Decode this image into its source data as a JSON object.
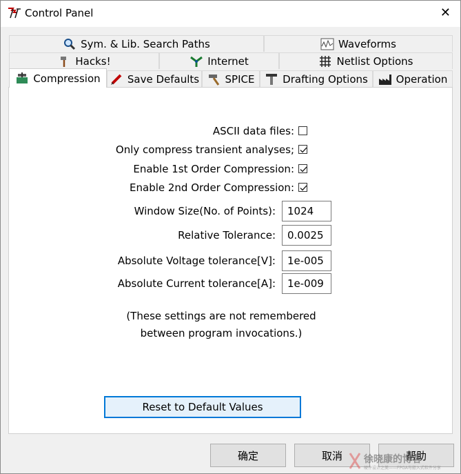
{
  "window": {
    "title": "Control Panel",
    "close_glyph": "✕"
  },
  "tabs_row1": [
    {
      "label": "Sym. & Lib. Search Paths",
      "icon": "magnifier-icon"
    },
    {
      "label": "Waveforms",
      "icon": "waveform-icon"
    }
  ],
  "tabs_row2": [
    {
      "label": "Hacks!",
      "icon": "axe-icon"
    },
    {
      "label": "Internet",
      "icon": "network-icon"
    },
    {
      "label": "Netlist Options",
      "icon": "netlist-grid-icon"
    }
  ],
  "tabs_row3": [
    {
      "label": "Compression",
      "icon": "compression-clamp-icon",
      "active": true
    },
    {
      "label": "Save Defaults",
      "icon": "pen-icon"
    },
    {
      "label": "SPICE",
      "icon": "hammer-icon"
    },
    {
      "label": "Drafting Options",
      "icon": "t-square-icon"
    },
    {
      "label": "Operation",
      "icon": "factory-icon"
    }
  ],
  "settings": {
    "ascii": {
      "label": "ASCII data files:",
      "checked": false
    },
    "only_transient": {
      "label": "Only compress transient analyses;",
      "checked": true
    },
    "first_order": {
      "label": "Enable 1st Order Compression:",
      "checked": true
    },
    "second_order": {
      "label": "Enable 2nd Order Compression:",
      "checked": true
    },
    "window_size": {
      "label": "Window Size(No. of Points):",
      "value": "1024"
    },
    "rel_tol": {
      "label": "Relative Tolerance:",
      "value": "0.0025"
    },
    "abs_v_tol": {
      "label": "Absolute Voltage tolerance[V]:",
      "value": "1e-005"
    },
    "abs_i_tol": {
      "label": "Absolute Current tolerance[A]:",
      "value": "1e-009"
    }
  },
  "note": {
    "line1": "(These settings are not remembered",
    "line2": "between program invocations.)"
  },
  "reset_button": "Reset to Default Values",
  "footer": {
    "ok": "确定",
    "cancel": "取消",
    "help": "帮助"
  },
  "watermark": {
    "text": "徐晓康的博客",
    "subtext": "硬件设计之美——FPGA与嵌入式软件分享"
  },
  "colors": {
    "accent": "#0078d7",
    "panel": "#ffffff",
    "chrome": "#f0f0f0"
  }
}
